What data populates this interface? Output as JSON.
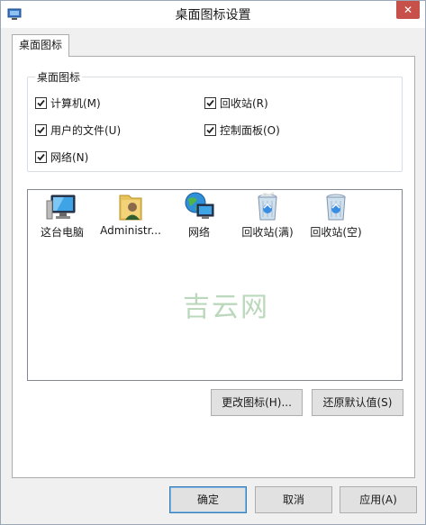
{
  "window": {
    "title": "桌面图标设置",
    "close_label": "✕"
  },
  "tab": {
    "label": "桌面图标"
  },
  "group": {
    "title": "桌面图标",
    "checkboxes": [
      {
        "label": "计算机(M)",
        "checked": true
      },
      {
        "label": "回收站(R)",
        "checked": true
      },
      {
        "label": "用户的文件(U)",
        "checked": true
      },
      {
        "label": "控制面板(O)",
        "checked": true
      },
      {
        "label": "网络(N)",
        "checked": true
      }
    ]
  },
  "icons": [
    {
      "label": "这台电脑",
      "icon": "computer-icon"
    },
    {
      "label": "Administr...",
      "icon": "user-folder-icon"
    },
    {
      "label": "网络",
      "icon": "network-icon"
    },
    {
      "label": "回收站(满)",
      "icon": "recycle-bin-full-icon"
    },
    {
      "label": "回收站(空)",
      "icon": "recycle-bin-empty-icon"
    }
  ],
  "watermark": "吉云网",
  "buttons": {
    "change_icon": "更改图标(H)...",
    "restore_default": "还原默认值(S)",
    "ok": "确定",
    "cancel": "取消",
    "apply": "应用(A)"
  }
}
